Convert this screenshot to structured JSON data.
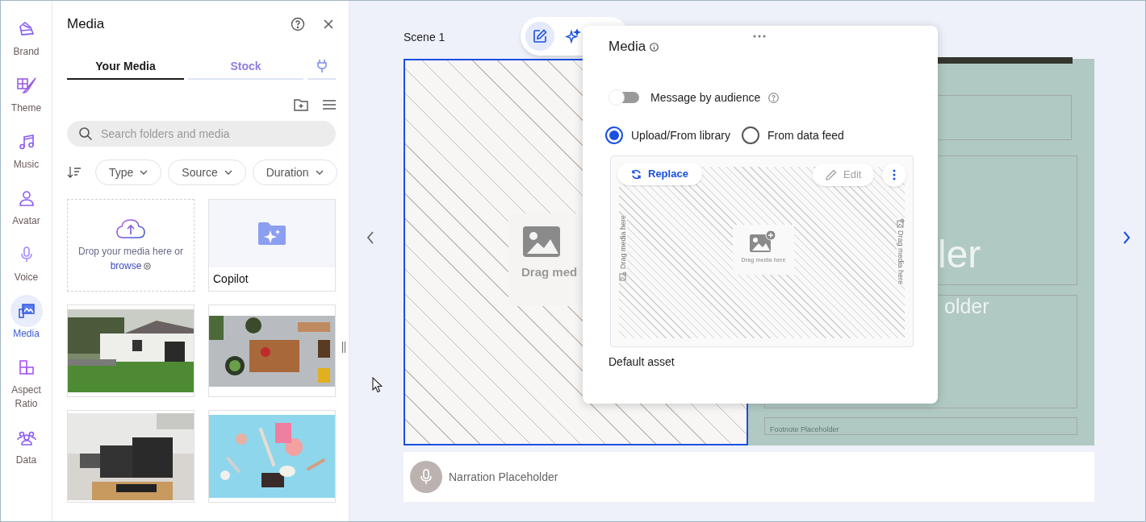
{
  "nav_rail": {
    "items": [
      {
        "label": "Brand",
        "selected": false
      },
      {
        "label": "Theme",
        "selected": false
      },
      {
        "label": "Music",
        "selected": false
      },
      {
        "label": "Avatar",
        "selected": false
      },
      {
        "label": "Voice",
        "selected": false
      },
      {
        "label": "Media",
        "selected": true
      },
      {
        "label": "Aspect Ratio",
        "selected": false
      },
      {
        "label": "Data",
        "selected": false
      }
    ]
  },
  "media_panel": {
    "title": "Media",
    "tabs": [
      {
        "label": "Your Media",
        "selected": true
      },
      {
        "label": "Stock",
        "selected": false
      }
    ],
    "search": {
      "placeholder": "Search folders and media"
    },
    "filters": [
      "Type",
      "Source",
      "Duration"
    ],
    "items": [
      {
        "kind": "upload",
        "text": "Drop your media here or",
        "link": "browse"
      },
      {
        "kind": "folder",
        "label": "Copilot"
      },
      {
        "kind": "picture"
      },
      {
        "kind": "picture"
      },
      {
        "kind": "picture"
      },
      {
        "kind": "picture"
      }
    ]
  },
  "canvas": {
    "scene_label": "Scene 1",
    "toolbar": [
      {
        "selected": true
      },
      {
        "selected": false
      }
    ],
    "scene": {
      "selected": true,
      "drag_text": "Drag med",
      "title_fragment": "ler",
      "subtitle_fragment": "older",
      "footnote": "Footnote Placeholder"
    },
    "narration": "Narration Placeholder"
  },
  "popover": {
    "title": "Media",
    "toggle": {
      "label": "Message by audience",
      "on": false
    },
    "sources": [
      {
        "label": "Upload/From library",
        "selected": true
      },
      {
        "label": "From data feed",
        "selected": false
      }
    ],
    "preview": {
      "replace": "Replace",
      "edit": {
        "label": "Edit",
        "disabled": true
      },
      "center_text": "Drag media here",
      "side_texts": [
        "Drag media here",
        "Drag media here"
      ]
    },
    "caption": "Default asset"
  }
}
